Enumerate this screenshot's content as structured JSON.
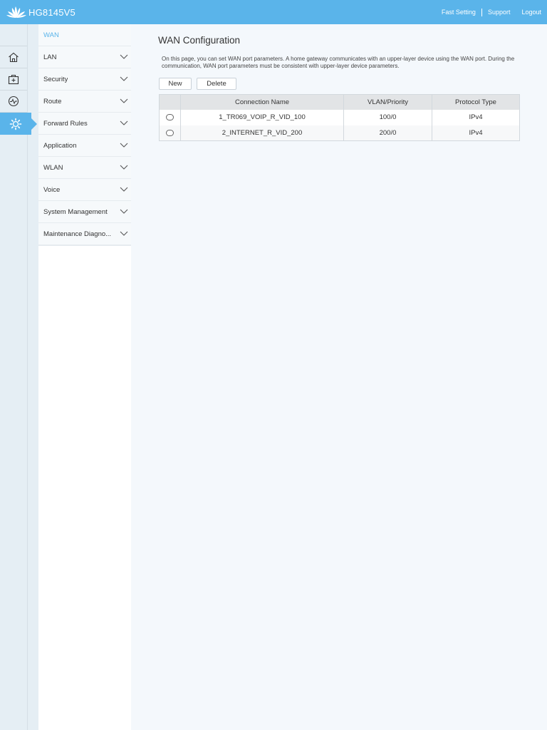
{
  "header": {
    "model": "HG8145V5",
    "links": [
      {
        "label": "Fast Setting"
      },
      {
        "label": "Support"
      },
      {
        "label": "Logout"
      }
    ]
  },
  "rail": {
    "items": [
      {
        "icon": "home-icon"
      },
      {
        "icon": "plus-box-icon"
      },
      {
        "icon": "pulse-icon"
      },
      {
        "icon": "gear-icon",
        "active": true
      }
    ]
  },
  "sidebar": {
    "items": [
      {
        "label": "WAN",
        "current": true
      },
      {
        "label": "LAN"
      },
      {
        "label": "Security"
      },
      {
        "label": "Route"
      },
      {
        "label": "Forward Rules"
      },
      {
        "label": "Application"
      },
      {
        "label": "WLAN"
      },
      {
        "label": "Voice"
      },
      {
        "label": "System Management"
      },
      {
        "label": "Maintenance Diagno..."
      }
    ]
  },
  "main": {
    "title": "WAN Configuration",
    "description": "On this page, you can set WAN port parameters. A home gateway communicates with an upper-layer device using the WAN port. During the communication, WAN port parameters must be consistent with upper-layer device parameters.",
    "buttons": {
      "new": "New",
      "delete": "Delete"
    },
    "table": {
      "columns": [
        "",
        "Connection Name",
        "VLAN/Priority",
        "Protocol Type"
      ],
      "rows": [
        {
          "name": "1_TR069_VOIP_R_VID_100",
          "vlan": "100/0",
          "protocol": "IPv4"
        },
        {
          "name": "2_INTERNET_R_VID_200",
          "vlan": "200/0",
          "protocol": "IPv4"
        }
      ]
    }
  },
  "colors": {
    "accent": "#5ab4ea",
    "page_bg": "#f4f8fc",
    "rail_bg": "#e5eef4"
  }
}
